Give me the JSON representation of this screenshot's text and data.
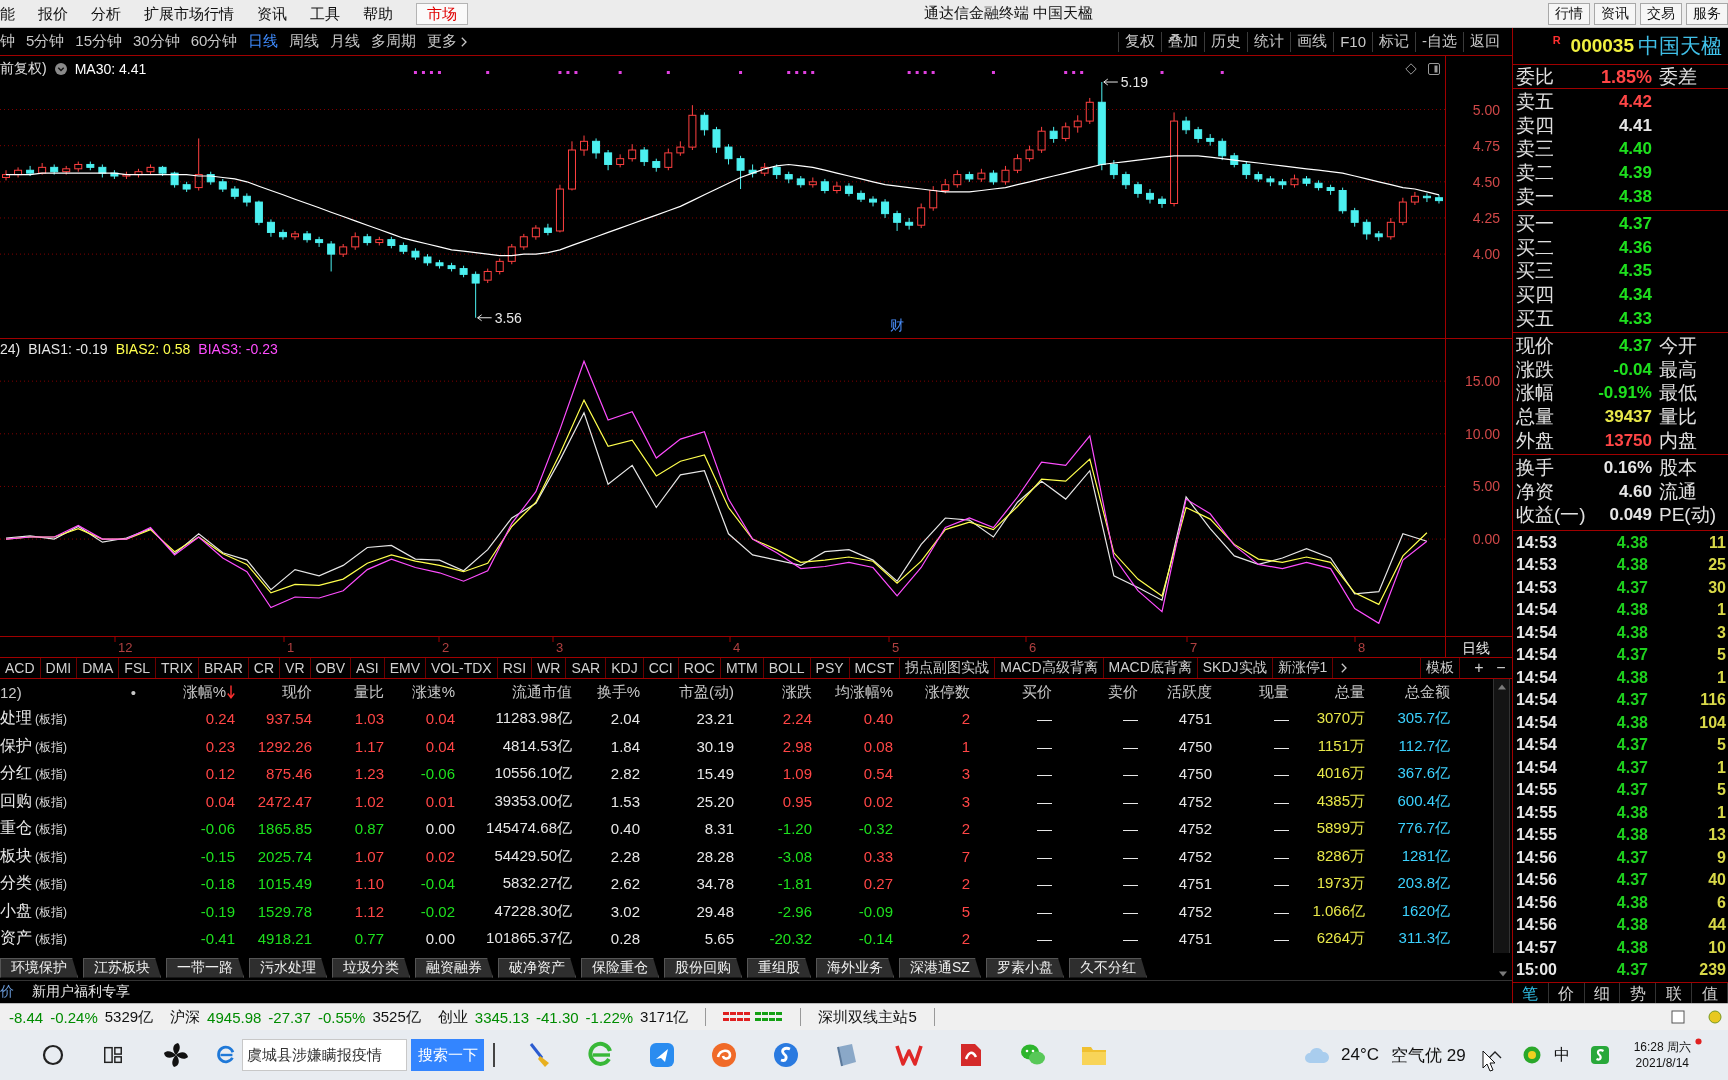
{
  "menu_bar": {
    "items": [
      {
        "label": "能",
        "selected": false
      },
      {
        "label": "报价",
        "selected": false
      },
      {
        "label": "分析",
        "selected": false
      },
      {
        "label": "扩展市场行情",
        "selected": false
      },
      {
        "label": "资讯",
        "selected": false
      },
      {
        "label": "工具",
        "selected": false
      },
      {
        "label": "帮助",
        "selected": false
      },
      {
        "label": "市场",
        "selected": true
      }
    ],
    "title": "通达信金融终端 中国天楹",
    "buttons": [
      "行情",
      "资讯",
      "交易",
      "服务"
    ]
  },
  "period_bar": {
    "periods": [
      {
        "label": "钟",
        "selected": false
      },
      {
        "label": "5分钟",
        "selected": false
      },
      {
        "label": "15分钟",
        "selected": false
      },
      {
        "label": "30分钟",
        "selected": false
      },
      {
        "label": "60分钟",
        "selected": false
      },
      {
        "label": "日线",
        "selected": true
      },
      {
        "label": "周线",
        "selected": false
      },
      {
        "label": "月线",
        "selected": false
      },
      {
        "label": "多周期",
        "selected": false
      }
    ],
    "more": "更多",
    "tools": [
      "复权",
      "叠加",
      "历史",
      "统计",
      "画线",
      "F10",
      "标记",
      "-自选",
      "返回"
    ]
  },
  "price_pane": {
    "title": "前复权)",
    "legend": [
      {
        "text": "MA30: 4.41",
        "color": "#ffffff"
      }
    ],
    "high_label": "5.19",
    "low_label": "3.56",
    "finance_mark": "财",
    "chart_data": {
      "type": "candlestick",
      "grid": true,
      "ylim": [
        3.42,
        5.37
      ],
      "yticks": [
        {
          "value": 4,
          "label": "4.00"
        },
        {
          "value": 4.25,
          "label": "4.25"
        },
        {
          "value": 4.5,
          "label": "4.50"
        },
        {
          "value": 4.75,
          "label": "4.75"
        },
        {
          "value": 5,
          "label": "5.00"
        }
      ],
      "ohlc": [
        [
          4.53,
          4.58,
          4.51,
          4.55
        ],
        [
          4.55,
          4.6,
          4.53,
          4.58
        ],
        [
          4.58,
          4.61,
          4.54,
          4.56
        ],
        [
          4.56,
          4.63,
          4.55,
          4.6
        ],
        [
          4.6,
          4.62,
          4.55,
          4.57
        ],
        [
          4.57,
          4.61,
          4.55,
          4.59
        ],
        [
          4.59,
          4.64,
          4.57,
          4.62
        ],
        [
          4.62,
          4.64,
          4.58,
          4.6
        ],
        [
          4.6,
          4.62,
          4.53,
          4.56
        ],
        [
          4.56,
          4.58,
          4.52,
          4.54
        ],
        [
          4.54,
          4.57,
          4.52,
          4.55
        ],
        [
          4.55,
          4.59,
          4.53,
          4.57
        ],
        [
          4.57,
          4.62,
          4.55,
          4.6
        ],
        [
          4.6,
          4.61,
          4.54,
          4.56
        ],
        [
          4.56,
          4.57,
          4.46,
          4.48
        ],
        [
          4.48,
          4.5,
          4.43,
          4.45
        ],
        [
          4.46,
          4.8,
          4.44,
          4.55
        ],
        [
          4.55,
          4.57,
          4.48,
          4.5
        ],
        [
          4.5,
          4.52,
          4.43,
          4.45
        ],
        [
          4.45,
          4.47,
          4.38,
          4.4
        ],
        [
          4.4,
          4.42,
          4.33,
          4.36
        ],
        [
          4.36,
          4.37,
          4.2,
          4.22
        ],
        [
          4.22,
          4.24,
          4.12,
          4.15
        ],
        [
          4.15,
          4.17,
          4.1,
          4.12
        ],
        [
          4.12,
          4.16,
          4.1,
          4.14
        ],
        [
          4.14,
          4.16,
          4.08,
          4.1
        ],
        [
          4.1,
          4.12,
          4.05,
          4.08
        ],
        [
          4.07,
          4.09,
          3.88,
          4.0
        ],
        [
          4.0,
          4.07,
          3.98,
          4.05
        ],
        [
          4.05,
          4.15,
          4.03,
          4.12
        ],
        [
          4.12,
          4.14,
          4.06,
          4.08
        ],
        [
          4.08,
          4.12,
          4.06,
          4.1
        ],
        [
          4.1,
          4.12,
          4.04,
          4.06
        ],
        [
          4.06,
          4.08,
          4.0,
          4.02
        ],
        [
          4.02,
          4.04,
          3.96,
          3.98
        ],
        [
          3.98,
          4.0,
          3.92,
          3.94
        ],
        [
          3.94,
          3.96,
          3.9,
          3.92
        ],
        [
          3.92,
          3.94,
          3.88,
          3.9
        ],
        [
          3.9,
          3.92,
          3.84,
          3.86
        ],
        [
          3.86,
          3.88,
          3.56,
          3.8
        ],
        [
          3.82,
          3.9,
          3.8,
          3.88
        ],
        [
          3.88,
          3.97,
          3.86,
          3.95
        ],
        [
          3.95,
          4.07,
          3.93,
          4.05
        ],
        [
          4.05,
          4.14,
          4.03,
          4.12
        ],
        [
          4.12,
          4.2,
          4.1,
          4.18
        ],
        [
          4.18,
          4.21,
          4.13,
          4.15
        ],
        [
          4.16,
          4.48,
          4.15,
          4.45
        ],
        [
          4.45,
          4.78,
          4.44,
          4.72
        ],
        [
          4.72,
          4.82,
          4.68,
          4.78
        ],
        [
          4.78,
          4.8,
          4.66,
          4.7
        ],
        [
          4.7,
          4.72,
          4.58,
          4.62
        ],
        [
          4.62,
          4.69,
          4.6,
          4.66
        ],
        [
          4.66,
          4.76,
          4.64,
          4.72
        ],
        [
          4.72,
          4.74,
          4.61,
          4.64
        ],
        [
          4.64,
          4.66,
          4.57,
          4.6
        ],
        [
          4.6,
          4.73,
          4.58,
          4.7
        ],
        [
          4.7,
          4.78,
          4.68,
          4.74
        ],
        [
          4.74,
          5.03,
          4.72,
          4.96
        ],
        [
          4.96,
          4.98,
          4.82,
          4.86
        ],
        [
          4.86,
          4.88,
          4.7,
          4.74
        ],
        [
          4.74,
          4.76,
          4.62,
          4.66
        ],
        [
          4.66,
          4.68,
          4.45,
          4.58
        ],
        [
          4.58,
          4.62,
          4.53,
          4.56
        ],
        [
          4.56,
          4.63,
          4.54,
          4.6
        ],
        [
          4.6,
          4.62,
          4.52,
          4.55
        ],
        [
          4.55,
          4.57,
          4.49,
          4.52
        ],
        [
          4.52,
          4.54,
          4.46,
          4.48
        ],
        [
          4.48,
          4.53,
          4.46,
          4.5
        ],
        [
          4.5,
          4.52,
          4.42,
          4.44
        ],
        [
          4.44,
          4.5,
          4.42,
          4.47
        ],
        [
          4.47,
          4.49,
          4.4,
          4.42
        ],
        [
          4.42,
          4.44,
          4.36,
          4.38
        ],
        [
          4.38,
          4.4,
          4.33,
          4.36
        ],
        [
          4.36,
          4.38,
          4.25,
          4.28
        ],
        [
          4.28,
          4.3,
          4.16,
          4.22
        ],
        [
          4.22,
          4.25,
          4.17,
          4.2
        ],
        [
          4.2,
          4.35,
          4.18,
          4.32
        ],
        [
          4.32,
          4.47,
          4.3,
          4.44
        ],
        [
          4.44,
          4.52,
          4.42,
          4.48
        ],
        [
          4.48,
          4.58,
          4.46,
          4.55
        ],
        [
          4.55,
          4.57,
          4.5,
          4.52
        ],
        [
          4.52,
          4.59,
          4.5,
          4.56
        ],
        [
          4.56,
          4.58,
          4.48,
          4.5
        ],
        [
          4.5,
          4.61,
          4.48,
          4.58
        ],
        [
          4.58,
          4.69,
          4.56,
          4.66
        ],
        [
          4.66,
          4.75,
          4.64,
          4.72
        ],
        [
          4.72,
          4.88,
          4.7,
          4.85
        ],
        [
          4.85,
          4.88,
          4.77,
          4.8
        ],
        [
          4.8,
          4.91,
          4.78,
          4.88
        ],
        [
          4.88,
          4.96,
          4.84,
          4.92
        ],
        [
          4.92,
          5.08,
          4.9,
          5.05
        ],
        [
          5.05,
          5.19,
          4.58,
          4.62
        ],
        [
          4.62,
          4.65,
          4.52,
          4.55
        ],
        [
          4.55,
          4.57,
          4.45,
          4.48
        ],
        [
          4.48,
          4.5,
          4.39,
          4.42
        ],
        [
          4.42,
          4.45,
          4.35,
          4.38
        ],
        [
          4.38,
          4.4,
          4.32,
          4.35
        ],
        [
          4.35,
          4.98,
          4.33,
          4.92
        ],
        [
          4.92,
          4.95,
          4.83,
          4.86
        ],
        [
          4.86,
          4.88,
          4.77,
          4.8
        ],
        [
          4.8,
          4.83,
          4.75,
          4.78
        ],
        [
          4.78,
          4.8,
          4.65,
          4.68
        ],
        [
          4.68,
          4.7,
          4.6,
          4.62
        ],
        [
          4.62,
          4.64,
          4.52,
          4.55
        ],
        [
          4.55,
          4.57,
          4.5,
          4.52
        ],
        [
          4.52,
          4.54,
          4.47,
          4.5
        ],
        [
          4.5,
          4.52,
          4.45,
          4.48
        ],
        [
          4.48,
          4.55,
          4.46,
          4.52
        ],
        [
          4.52,
          4.54,
          4.47,
          4.49
        ],
        [
          4.49,
          4.51,
          4.44,
          4.46
        ],
        [
          4.46,
          4.48,
          4.41,
          4.44
        ],
        [
          4.44,
          4.46,
          4.28,
          4.3
        ],
        [
          4.3,
          4.32,
          4.19,
          4.22
        ],
        [
          4.22,
          4.24,
          4.1,
          4.14
        ],
        [
          4.14,
          4.16,
          4.09,
          4.12
        ],
        [
          4.12,
          4.25,
          4.1,
          4.22
        ],
        [
          4.22,
          4.39,
          4.2,
          4.36
        ],
        [
          4.36,
          4.43,
          4.34,
          4.4
        ],
        [
          4.4,
          4.42,
          4.36,
          4.39
        ],
        [
          4.39,
          4.41,
          4.35,
          4.37
        ]
      ],
      "series": [
        {
          "type": "line",
          "color": "#ffffff",
          "values": [
            4.55,
            4.55,
            4.55,
            4.56,
            4.56,
            4.56,
            4.56,
            4.56,
            4.56,
            4.56,
            4.55,
            4.55,
            4.55,
            4.55,
            4.55,
            4.55,
            4.54,
            4.54,
            4.53,
            4.52,
            4.5,
            4.47,
            4.44,
            4.41,
            4.38,
            4.35,
            4.32,
            4.29,
            4.26,
            4.23,
            4.2,
            4.17,
            4.14,
            4.11,
            4.09,
            4.07,
            4.05,
            4.03,
            4.02,
            4.01,
            4.0,
            3.99,
            3.99,
            4.0,
            4.0,
            4.01,
            4.03,
            4.06,
            4.09,
            4.12,
            4.15,
            4.18,
            4.21,
            4.24,
            4.27,
            4.3,
            4.33,
            4.37,
            4.41,
            4.45,
            4.49,
            4.53,
            4.56,
            4.59,
            4.61,
            4.62,
            4.61,
            4.6,
            4.58,
            4.56,
            4.54,
            4.52,
            4.5,
            4.48,
            4.47,
            4.46,
            4.45,
            4.44,
            4.43,
            4.43,
            4.43,
            4.44,
            4.45,
            4.46,
            4.48,
            4.5,
            4.52,
            4.54,
            4.56,
            4.58,
            4.6,
            4.62,
            4.63,
            4.64,
            4.65,
            4.66,
            4.67,
            4.68,
            4.68,
            4.68,
            4.67,
            4.66,
            4.65,
            4.64,
            4.63,
            4.62,
            4.61,
            4.6,
            4.59,
            4.58,
            4.57,
            4.56,
            4.54,
            4.52,
            4.5,
            4.48,
            4.46,
            4.45,
            4.43,
            4.41
          ]
        }
      ]
    }
  },
  "bias_pane": {
    "legend": [
      {
        "text": "24)",
        "color": "#e6e6e6"
      },
      {
        "text": "BIAS1: -0.19",
        "color": "#e6e6e6"
      },
      {
        "text": "BIAS2: 0.58",
        "color": "#ffff4d"
      },
      {
        "text": "BIAS3: -0.23",
        "color": "#ff4dff"
      }
    ],
    "chart_data": {
      "type": "line",
      "grid": true,
      "ylim": [
        -9.3,
        19.1
      ],
      "yticks": [
        {
          "value": 0,
          "label": "0.00"
        },
        {
          "value": 5,
          "label": "5.00"
        },
        {
          "value": 10,
          "label": "10.00"
        },
        {
          "value": 15,
          "label": "15.00"
        }
      ],
      "series": [
        {
          "color": "#e6e6e6",
          "values": [
            0.1,
            0.3,
            0.0,
            1.2,
            -0.3,
            0.1,
            1.0,
            -1.4,
            0.5,
            -1.3,
            -2.0,
            -4.8,
            -2.9,
            -3.5,
            -2.5,
            -0.8,
            -0.6,
            -1.9,
            -2.0,
            -3.0,
            -1.0,
            2.0,
            3.4,
            7.5,
            12.0,
            5.2,
            7.0,
            3.0,
            6.1,
            6.5,
            0.5,
            -1.5,
            -2.0,
            -2.5,
            -1.2,
            -1.0,
            -2.0,
            -4.0,
            -0.5,
            2.0,
            1.8,
            0.2,
            3.5,
            5.5,
            3.8,
            6.5,
            -3.5,
            -4.6,
            -5.8,
            4.0,
            1.0,
            -1.6,
            -2.4,
            -1.8,
            -0.9,
            -1.8,
            -5.2,
            -5.0,
            0.5,
            -0.2
          ]
        },
        {
          "color": "#ffff4d",
          "values": [
            0,
            0.2,
            0.2,
            1.0,
            0,
            0,
            0.9,
            -1.2,
            0.2,
            -1.4,
            -2.4,
            -5.1,
            -4.3,
            -4.4,
            -3.8,
            -2.3,
            -1.5,
            -2.1,
            -2.5,
            -3.1,
            -2.3,
            1.2,
            3.5,
            8.1,
            13.2,
            8.8,
            9.4,
            6.0,
            7.4,
            8.0,
            3.0,
            0,
            -1.0,
            -2.2,
            -2.0,
            -1.7,
            -2.1,
            -4.2,
            -2.1,
            0.9,
            1.6,
            0.9,
            3.1,
            5.7,
            5.5,
            7.6,
            -1.3,
            -3.8,
            -5.4,
            3.0,
            1.9,
            -0.5,
            -1.9,
            -2.2,
            -1.7,
            -2.2,
            -5.1,
            -6.2,
            -1.6,
            0.6
          ]
        },
        {
          "color": "#ff4dff",
          "values": [
            0,
            0.2,
            0.2,
            1.3,
            0,
            0,
            1.1,
            -1.5,
            0.2,
            -1.8,
            -3.1,
            -6.5,
            -5.5,
            -5.6,
            -4.9,
            -2.9,
            -1.9,
            -2.7,
            -3.2,
            -4.0,
            -3.0,
            1.5,
            4.5,
            10.4,
            16.9,
            11.3,
            12.1,
            7.7,
            9.5,
            10.2,
            3.8,
            0,
            -1.3,
            -2.8,
            -2.6,
            -2.2,
            -2.7,
            -5.4,
            -2.7,
            1.1,
            2.0,
            1.1,
            4.0,
            7.3,
            7.0,
            9.8,
            -1.7,
            -4.9,
            -6.9,
            3.8,
            2.4,
            -0.6,
            -2.4,
            -2.8,
            -2.2,
            -2.8,
            -6.6,
            -8.0,
            -2.0,
            -0.2
          ]
        }
      ]
    }
  },
  "date_axis": {
    "labels": [
      "12",
      "1",
      "2",
      "3",
      "4",
      "5",
      "6",
      "7",
      "8"
    ],
    "period": "日线"
  },
  "indicator_tabs": {
    "items": [
      "ACD",
      "DMI",
      "DMA",
      "FSL",
      "TRIX",
      "BRAR",
      "CR",
      "VR",
      "OBV",
      "ASI",
      "EMV",
      "VOL-TDX",
      "RSI",
      "WR",
      "SAR",
      "KDJ",
      "CCI",
      "ROC",
      "MTM",
      "BOLL",
      "PSY",
      "MCST",
      "拐点副图实战",
      "MACD高级背离",
      "MACD底背离",
      "SKDJ实战",
      "新涨停1"
    ],
    "template": "模板",
    "add": "+",
    "remove": "−"
  },
  "sector_table": {
    "columns": [
      {
        "label": "12)",
        "note": "•",
        "sorted": false
      },
      {
        "label": "涨幅%",
        "sorted": true
      },
      {
        "label": "现价",
        "sorted": false
      },
      {
        "label": "量比",
        "sorted": false
      },
      {
        "label": "涨速%",
        "sorted": false
      },
      {
        "label": "流通市值",
        "sorted": false
      },
      {
        "label": "换手%",
        "sorted": false
      },
      {
        "label": "市盈(动)",
        "sorted": false
      },
      {
        "label": "涨跌",
        "sorted": false
      },
      {
        "label": "均涨幅%",
        "sorted": false
      },
      {
        "label": "涨停数",
        "sorted": false
      },
      {
        "label": "买价",
        "sorted": false
      },
      {
        "label": "卖价",
        "sorted": false
      },
      {
        "label": "活跃度",
        "sorted": false
      },
      {
        "label": "现量",
        "sorted": false
      },
      {
        "label": "总量",
        "sorted": false
      },
      {
        "label": "总金额",
        "sorted": false
      }
    ],
    "rows": [
      {
        "cells": [
          {
            "text": "处理",
            "tag": "(板指)"
          },
          {
            "text": "0.24",
            "color": "#ff4646"
          },
          {
            "text": "937.54",
            "color": "#ff4646"
          },
          {
            "text": "1.03",
            "color": "#ff4646"
          },
          {
            "text": "0.04",
            "color": "#ff4646"
          },
          {
            "text": "11283.98亿",
            "color": "#e6e6e6"
          },
          {
            "text": "2.04",
            "color": "#e6e6e6"
          },
          {
            "text": "23.21",
            "color": "#e6e6e6"
          },
          {
            "text": "2.24",
            "color": "#ff4646"
          },
          {
            "text": "0.40",
            "color": "#ff4646"
          },
          {
            "text": "2",
            "color": "#ff4646"
          },
          {
            "text": "—",
            "color": "#e6e6e6"
          },
          {
            "text": "—",
            "color": "#e6e6e6"
          },
          {
            "text": "4751",
            "color": "#e6e6e6"
          },
          {
            "text": "—",
            "color": "#e6e6e6"
          },
          {
            "text": "3070万",
            "color": "#e8e84a"
          },
          {
            "text": "305.7亿",
            "color": "#3cd2ff"
          }
        ]
      },
      {
        "cells": [
          {
            "text": "保护",
            "tag": "(板指)"
          },
          {
            "text": "0.23",
            "color": "#ff4646"
          },
          {
            "text": "1292.26",
            "color": "#ff4646"
          },
          {
            "text": "1.17",
            "color": "#ff4646"
          },
          {
            "text": "0.04",
            "color": "#ff4646"
          },
          {
            "text": "4814.53亿",
            "color": "#e6e6e6"
          },
          {
            "text": "1.84",
            "color": "#e6e6e6"
          },
          {
            "text": "30.19",
            "color": "#e6e6e6"
          },
          {
            "text": "2.98",
            "color": "#ff4646"
          },
          {
            "text": "0.08",
            "color": "#ff4646"
          },
          {
            "text": "1",
            "color": "#ff4646"
          },
          {
            "text": "—",
            "color": "#e6e6e6"
          },
          {
            "text": "—",
            "color": "#e6e6e6"
          },
          {
            "text": "4750",
            "color": "#e6e6e6"
          },
          {
            "text": "—",
            "color": "#e6e6e6"
          },
          {
            "text": "1151万",
            "color": "#e8e84a"
          },
          {
            "text": "112.7亿",
            "color": "#3cd2ff"
          }
        ]
      },
      {
        "cells": [
          {
            "text": "分红",
            "tag": "(板指)"
          },
          {
            "text": "0.12",
            "color": "#ff4646"
          },
          {
            "text": "875.46",
            "color": "#ff4646"
          },
          {
            "text": "1.23",
            "color": "#ff4646"
          },
          {
            "text": "-0.06",
            "color": "#1ee01e"
          },
          {
            "text": "10556.10亿",
            "color": "#e6e6e6"
          },
          {
            "text": "2.82",
            "color": "#e6e6e6"
          },
          {
            "text": "15.49",
            "color": "#e6e6e6"
          },
          {
            "text": "1.09",
            "color": "#ff4646"
          },
          {
            "text": "0.54",
            "color": "#ff4646"
          },
          {
            "text": "3",
            "color": "#ff4646"
          },
          {
            "text": "—",
            "color": "#e6e6e6"
          },
          {
            "text": "—",
            "color": "#e6e6e6"
          },
          {
            "text": "4750",
            "color": "#e6e6e6"
          },
          {
            "text": "—",
            "color": "#e6e6e6"
          },
          {
            "text": "4016万",
            "color": "#e8e84a"
          },
          {
            "text": "367.6亿",
            "color": "#3cd2ff"
          }
        ]
      },
      {
        "cells": [
          {
            "text": "回购",
            "tag": "(板指)"
          },
          {
            "text": "0.04",
            "color": "#ff4646"
          },
          {
            "text": "2472.47",
            "color": "#ff4646"
          },
          {
            "text": "1.02",
            "color": "#ff4646"
          },
          {
            "text": "0.01",
            "color": "#ff4646"
          },
          {
            "text": "39353.00亿",
            "color": "#e6e6e6"
          },
          {
            "text": "1.53",
            "color": "#e6e6e6"
          },
          {
            "text": "25.20",
            "color": "#e6e6e6"
          },
          {
            "text": "0.95",
            "color": "#ff4646"
          },
          {
            "text": "0.02",
            "color": "#ff4646"
          },
          {
            "text": "3",
            "color": "#ff4646"
          },
          {
            "text": "—",
            "color": "#e6e6e6"
          },
          {
            "text": "—",
            "color": "#e6e6e6"
          },
          {
            "text": "4752",
            "color": "#e6e6e6"
          },
          {
            "text": "—",
            "color": "#e6e6e6"
          },
          {
            "text": "4385万",
            "color": "#e8e84a"
          },
          {
            "text": "600.4亿",
            "color": "#3cd2ff"
          }
        ]
      },
      {
        "cells": [
          {
            "text": "重仓",
            "tag": "(板指)"
          },
          {
            "text": "-0.06",
            "color": "#1ee01e"
          },
          {
            "text": "1865.85",
            "color": "#1ee01e"
          },
          {
            "text": "0.87",
            "color": "#1ee01e"
          },
          {
            "text": "0.00",
            "color": "#e6e6e6"
          },
          {
            "text": "145474.68亿",
            "color": "#e6e6e6"
          },
          {
            "text": "0.40",
            "color": "#e6e6e6"
          },
          {
            "text": "8.31",
            "color": "#e6e6e6"
          },
          {
            "text": "-1.20",
            "color": "#1ee01e"
          },
          {
            "text": "-0.32",
            "color": "#1ee01e"
          },
          {
            "text": "2",
            "color": "#ff4646"
          },
          {
            "text": "—",
            "color": "#e6e6e6"
          },
          {
            "text": "—",
            "color": "#e6e6e6"
          },
          {
            "text": "4752",
            "color": "#e6e6e6"
          },
          {
            "text": "—",
            "color": "#e6e6e6"
          },
          {
            "text": "5899万",
            "color": "#e8e84a"
          },
          {
            "text": "776.7亿",
            "color": "#3cd2ff"
          }
        ]
      },
      {
        "cells": [
          {
            "text": "板块",
            "tag": "(板指)"
          },
          {
            "text": "-0.15",
            "color": "#1ee01e"
          },
          {
            "text": "2025.74",
            "color": "#1ee01e"
          },
          {
            "text": "1.07",
            "color": "#ff4646"
          },
          {
            "text": "0.02",
            "color": "#ff4646"
          },
          {
            "text": "54429.50亿",
            "color": "#e6e6e6"
          },
          {
            "text": "2.28",
            "color": "#e6e6e6"
          },
          {
            "text": "28.28",
            "color": "#e6e6e6"
          },
          {
            "text": "-3.08",
            "color": "#1ee01e"
          },
          {
            "text": "0.33",
            "color": "#ff4646"
          },
          {
            "text": "7",
            "color": "#ff4646"
          },
          {
            "text": "—",
            "color": "#e6e6e6"
          },
          {
            "text": "—",
            "color": "#e6e6e6"
          },
          {
            "text": "4752",
            "color": "#e6e6e6"
          },
          {
            "text": "—",
            "color": "#e6e6e6"
          },
          {
            "text": "8286万",
            "color": "#e8e84a"
          },
          {
            "text": "1281亿",
            "color": "#3cd2ff"
          }
        ]
      },
      {
        "cells": [
          {
            "text": "分类",
            "tag": "(板指)"
          },
          {
            "text": "-0.18",
            "color": "#1ee01e"
          },
          {
            "text": "1015.49",
            "color": "#1ee01e"
          },
          {
            "text": "1.10",
            "color": "#ff4646"
          },
          {
            "text": "-0.04",
            "color": "#1ee01e"
          },
          {
            "text": "5832.27亿",
            "color": "#e6e6e6"
          },
          {
            "text": "2.62",
            "color": "#e6e6e6"
          },
          {
            "text": "34.78",
            "color": "#e6e6e6"
          },
          {
            "text": "-1.81",
            "color": "#1ee01e"
          },
          {
            "text": "0.27",
            "color": "#ff4646"
          },
          {
            "text": "2",
            "color": "#ff4646"
          },
          {
            "text": "—",
            "color": "#e6e6e6"
          },
          {
            "text": "—",
            "color": "#e6e6e6"
          },
          {
            "text": "4751",
            "color": "#e6e6e6"
          },
          {
            "text": "—",
            "color": "#e6e6e6"
          },
          {
            "text": "1973万",
            "color": "#e8e84a"
          },
          {
            "text": "203.8亿",
            "color": "#3cd2ff"
          }
        ]
      },
      {
        "cells": [
          {
            "text": "小盘",
            "tag": "(板指)"
          },
          {
            "text": "-0.19",
            "color": "#1ee01e"
          },
          {
            "text": "1529.78",
            "color": "#1ee01e"
          },
          {
            "text": "1.12",
            "color": "#ff4646"
          },
          {
            "text": "-0.02",
            "color": "#1ee01e"
          },
          {
            "text": "47228.30亿",
            "color": "#e6e6e6"
          },
          {
            "text": "3.02",
            "color": "#e6e6e6"
          },
          {
            "text": "29.48",
            "color": "#e6e6e6"
          },
          {
            "text": "-2.96",
            "color": "#1ee01e"
          },
          {
            "text": "-0.09",
            "color": "#1ee01e"
          },
          {
            "text": "5",
            "color": "#ff4646"
          },
          {
            "text": "—",
            "color": "#e6e6e6"
          },
          {
            "text": "—",
            "color": "#e6e6e6"
          },
          {
            "text": "4752",
            "color": "#e6e6e6"
          },
          {
            "text": "—",
            "color": "#e6e6e6"
          },
          {
            "text": "1.066亿",
            "color": "#e8e84a"
          },
          {
            "text": "1620亿",
            "color": "#3cd2ff"
          }
        ]
      },
      {
        "cells": [
          {
            "text": "资产",
            "tag": "(板指)"
          },
          {
            "text": "-0.41",
            "color": "#1ee01e"
          },
          {
            "text": "4918.21",
            "color": "#1ee01e"
          },
          {
            "text": "0.77",
            "color": "#1ee01e"
          },
          {
            "text": "0.00",
            "color": "#e6e6e6"
          },
          {
            "text": "101865.37亿",
            "color": "#e6e6e6"
          },
          {
            "text": "0.28",
            "color": "#e6e6e6"
          },
          {
            "text": "5.65",
            "color": "#e6e6e6"
          },
          {
            "text": "-20.32",
            "color": "#1ee01e"
          },
          {
            "text": "-0.14",
            "color": "#1ee01e"
          },
          {
            "text": "2",
            "color": "#ff4646"
          },
          {
            "text": "—",
            "color": "#e6e6e6"
          },
          {
            "text": "—",
            "color": "#e6e6e6"
          },
          {
            "text": "4751",
            "color": "#e6e6e6"
          },
          {
            "text": "—",
            "color": "#e6e6e6"
          },
          {
            "text": "6264万",
            "color": "#e8e84a"
          },
          {
            "text": "311.3亿",
            "color": "#3cd2ff"
          }
        ]
      }
    ]
  },
  "sector_tabs": [
    "环境保护",
    "江苏板块",
    "一带一路",
    "污水处理",
    "垃圾分类",
    "融资融券",
    "破净资产",
    "保险重仓",
    "股份回购",
    "重组股",
    "海外业务",
    "深港通SZ",
    "罗素小盘",
    "久不分红"
  ],
  "info_bar": {
    "tab": "价",
    "promo": "新用户福利专享"
  },
  "quote_panel": {
    "marker": "R",
    "code": "000035",
    "name": "中国天楹",
    "ratio": {
      "label": "委比",
      "value": "1.85%",
      "color": "#ff4646",
      "label2": "委差"
    },
    "asks": [
      {
        "label": "卖五",
        "price": "4.42",
        "color": "#ff4646"
      },
      {
        "label": "卖四",
        "price": "4.41",
        "color": "#e6e6e6"
      },
      {
        "label": "卖三",
        "price": "4.40",
        "color": "#1ee01e"
      },
      {
        "label": "卖二",
        "price": "4.39",
        "color": "#1ee01e"
      },
      {
        "label": "卖一",
        "price": "4.38",
        "color": "#1ee01e"
      }
    ],
    "bids": [
      {
        "label": "买一",
        "price": "4.37",
        "color": "#1ee01e"
      },
      {
        "label": "买二",
        "price": "4.36",
        "color": "#1ee01e"
      },
      {
        "label": "买三",
        "price": "4.35",
        "color": "#1ee01e"
      },
      {
        "label": "买四",
        "price": "4.34",
        "color": "#1ee01e"
      },
      {
        "label": "买五",
        "price": "4.33",
        "color": "#1ee01e"
      }
    ],
    "stats": [
      {
        "label": "现价",
        "value": "4.37",
        "color": "#1ee01e",
        "label2": "今开"
      },
      {
        "label": "涨跌",
        "value": "-0.04",
        "color": "#1ee01e",
        "label2": "最高"
      },
      {
        "label": "涨幅",
        "value": "-0.91%",
        "color": "#1ee01e",
        "label2": "最低"
      },
      {
        "label": "总量",
        "value": "39437",
        "color": "#e8e84a",
        "label2": "量比"
      },
      {
        "label": "外盘",
        "value": "13750",
        "color": "#ff4646",
        "label2": "内盘"
      }
    ],
    "fundamentals": [
      {
        "label": "换手",
        "value": "0.16%",
        "color": "#e6e6e6",
        "label2": "股本"
      },
      {
        "label": "净资",
        "value": "4.60",
        "color": "#e6e6e6",
        "label2": "流通"
      },
      {
        "label": "收益(一)",
        "value": "0.049",
        "color": "#e6e6e6",
        "label2": "PE(动)"
      }
    ],
    "ticks": [
      {
        "time": "14:53",
        "price": "4.38",
        "volume": "11"
      },
      {
        "time": "14:53",
        "price": "4.38",
        "volume": "25"
      },
      {
        "time": "14:53",
        "price": "4.37",
        "volume": "30"
      },
      {
        "time": "14:54",
        "price": "4.38",
        "volume": "1"
      },
      {
        "time": "14:54",
        "price": "4.38",
        "volume": "3"
      },
      {
        "time": "14:54",
        "price": "4.37",
        "volume": "5"
      },
      {
        "time": "14:54",
        "price": "4.38",
        "volume": "1"
      },
      {
        "time": "14:54",
        "price": "4.37",
        "volume": "116"
      },
      {
        "time": "14:54",
        "price": "4.38",
        "volume": "104"
      },
      {
        "time": "14:54",
        "price": "4.37",
        "volume": "5"
      },
      {
        "time": "14:54",
        "price": "4.37",
        "volume": "1"
      },
      {
        "time": "14:55",
        "price": "4.37",
        "volume": "5"
      },
      {
        "time": "14:55",
        "price": "4.38",
        "volume": "1"
      },
      {
        "time": "14:55",
        "price": "4.38",
        "volume": "13"
      },
      {
        "time": "14:56",
        "price": "4.37",
        "volume": "9"
      },
      {
        "time": "14:56",
        "price": "4.37",
        "volume": "40"
      },
      {
        "time": "14:56",
        "price": "4.38",
        "volume": "6"
      },
      {
        "time": "14:56",
        "price": "4.38",
        "volume": "44"
      },
      {
        "time": "14:57",
        "price": "4.38",
        "volume": "10"
      },
      {
        "time": "15:00",
        "price": "4.37",
        "volume": "239"
      }
    ],
    "tabs": [
      {
        "label": "笔",
        "selected": true
      },
      {
        "label": "价",
        "selected": false
      },
      {
        "label": "细",
        "selected": false
      },
      {
        "label": "势",
        "selected": false
      },
      {
        "label": "联",
        "selected": false
      },
      {
        "label": "值",
        "selected": false
      }
    ]
  },
  "status_bar": {
    "groups": [
      {
        "values": [
          {
            "text": "-8.44",
            "color": "#008c00"
          },
          {
            "text": "-0.24%",
            "color": "#008c00"
          },
          {
            "text": "5329亿",
            "color": "#111111"
          }
        ]
      },
      {
        "name": "沪深",
        "values": [
          {
            "text": "4945.98",
            "color": "#008c00"
          },
          {
            "text": "-27.37",
            "color": "#008c00"
          },
          {
            "text": "-0.55%",
            "color": "#008c00"
          },
          {
            "text": "3525亿",
            "color": "#111111"
          }
        ]
      },
      {
        "name": "创业",
        "values": [
          {
            "text": "3345.13",
            "color": "#008c00"
          },
          {
            "text": "-41.30",
            "color": "#008c00"
          },
          {
            "text": "-1.22%",
            "color": "#008c00"
          },
          {
            "text": "3171亿",
            "color": "#111111"
          }
        ]
      }
    ],
    "server": "深圳双线主站5"
  },
  "taskbar": {
    "search": {
      "value": "虞城县涉嫌瞒报疫情",
      "button": "搜索一下"
    },
    "temperature": "24°C",
    "air_quality": "空气优 29",
    "ime": "中",
    "time": "16:28 周六",
    "date": "2021/8/14"
  }
}
